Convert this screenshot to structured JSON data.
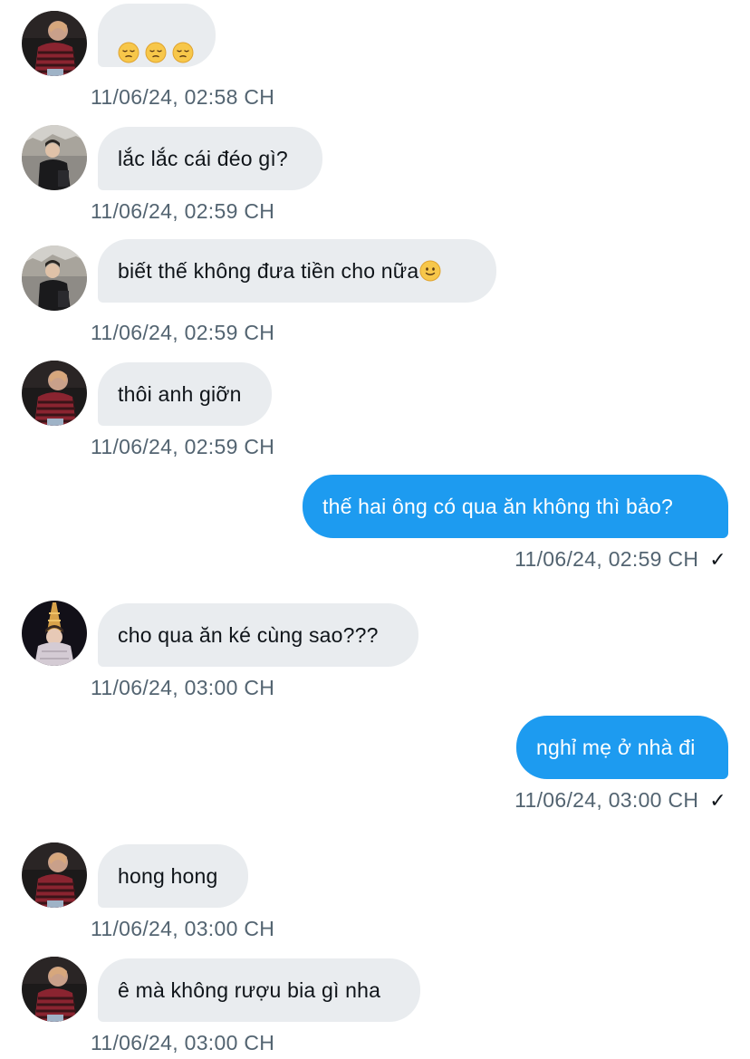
{
  "messages": [
    {
      "side": "in",
      "avatar": "user-a",
      "text": "",
      "emoji": [
        "pensive-face-emoji",
        "pensive-face-emoji",
        "pensive-face-emoji"
      ],
      "time": "11/06/24, 02:58 CH"
    },
    {
      "side": "in",
      "avatar": "user-b",
      "text": "lắc lắc cái đéo gì?",
      "time": "11/06/24, 02:59 CH"
    },
    {
      "side": "in",
      "avatar": "user-b",
      "text": "biết thế không đưa tiền cho nữa",
      "trailing_emoji": "slightly-smiling-face-emoji",
      "time": "11/06/24, 02:59 CH"
    },
    {
      "side": "in",
      "avatar": "user-a",
      "text": "thôi anh giỡn",
      "time": "11/06/24, 02:59 CH"
    },
    {
      "side": "out",
      "text": "thế hai ông có qua ăn không thì bảo?",
      "time": "11/06/24, 02:59 CH",
      "status": "✓"
    },
    {
      "side": "in",
      "avatar": "user-c",
      "text": "cho qua ăn ké cùng sao???",
      "time": "11/06/24, 03:00 CH"
    },
    {
      "side": "out",
      "text": "nghỉ mẹ ở nhà đi",
      "time": "11/06/24, 03:00 CH",
      "status": "✓"
    },
    {
      "side": "in",
      "avatar": "user-a",
      "text": "hong hong",
      "time": "11/06/24, 03:00 CH"
    },
    {
      "side": "in",
      "avatar": "user-a",
      "text": "ê mà không rượu bia gì nha",
      "time": "11/06/24, 03:00 CH"
    }
  ],
  "colors": {
    "incoming_bubble": "#e9ecef",
    "outgoing_bubble": "#1d9bf0",
    "timestamp": "#536471",
    "text": "#0f1419"
  }
}
